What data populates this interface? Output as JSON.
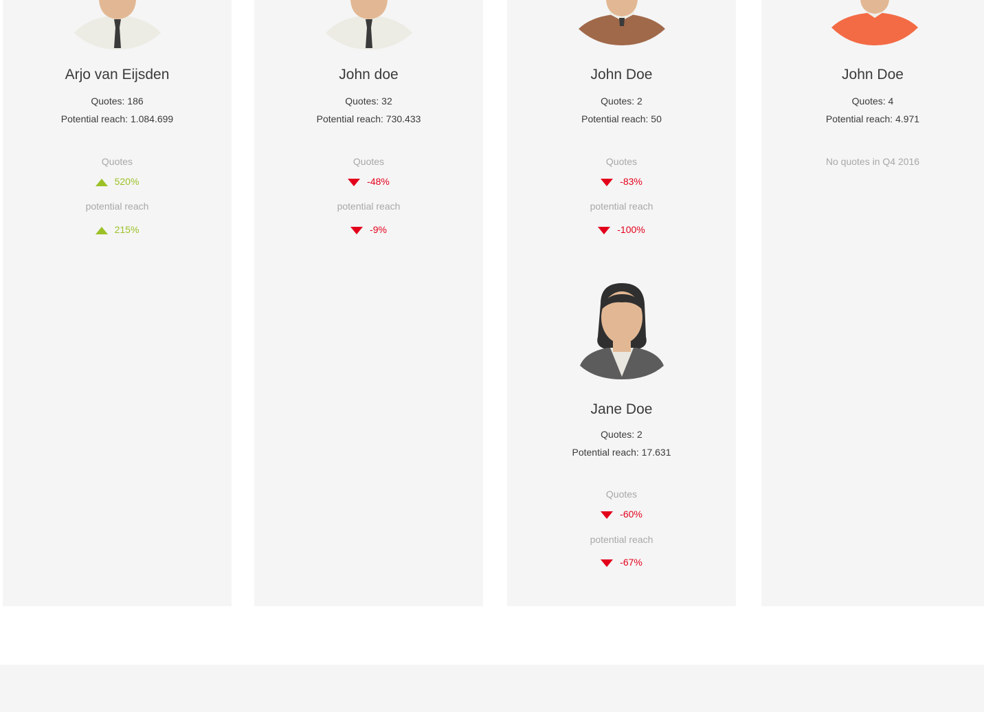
{
  "colors": {
    "panel": "#f5f5f5",
    "up": "#9cc128",
    "down": "#e3001b",
    "label": "#a8a8a8",
    "text": "#3a3a3a"
  },
  "people": [
    {
      "name": "Arjo van Eijsden",
      "quotes": "Quotes: 186",
      "reach": "Potential reach: 1.084.699",
      "quotes_label": "Quotes",
      "quotes_change": "520%",
      "quotes_dir": "up",
      "reach_label": "potential reach",
      "reach_change": "215%",
      "reach_dir": "up",
      "avatar": "man-white-shirt-tie-icon"
    },
    {
      "name": "John doe",
      "quotes": "Quotes: 32",
      "reach": "Potential reach: 730.433",
      "quotes_label": "Quotes",
      "quotes_change": "-48%",
      "quotes_dir": "down",
      "reach_label": "potential reach",
      "reach_change": "-9%",
      "reach_dir": "down",
      "avatar": "man-white-shirt-tie-icon"
    },
    {
      "name": "John Doe",
      "quotes": "Quotes: 2",
      "reach": "Potential reach: 50",
      "quotes_label": "Quotes",
      "quotes_change": "-83%",
      "quotes_dir": "down",
      "reach_label": "potential reach",
      "reach_change": "-100%",
      "reach_dir": "down",
      "avatar": "man-brown-sweater-icon"
    },
    {
      "name": "Jane Doe",
      "quotes": "Quotes: 2",
      "reach": "Potential reach: 17.631",
      "quotes_label": "Quotes",
      "quotes_change": "-60%",
      "quotes_dir": "down",
      "reach_label": "potential reach",
      "reach_change": "-67%",
      "reach_dir": "down",
      "avatar": "woman-grey-blazer-icon"
    },
    {
      "name": "John Doe",
      "quotes": "Quotes: 4",
      "reach": "Potential reach: 4.971",
      "no_quotes": "No quotes in Q4 2016",
      "avatar": "man-orange-sweater-icon"
    }
  ]
}
